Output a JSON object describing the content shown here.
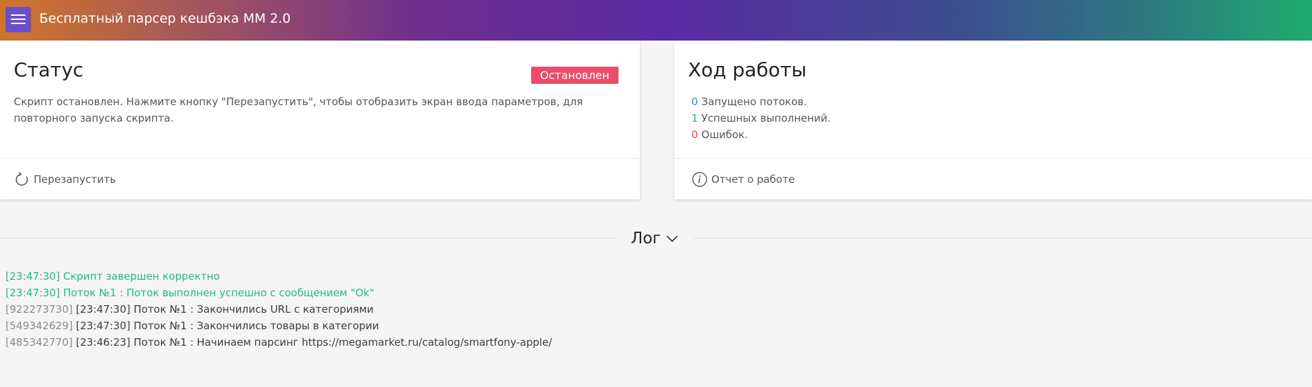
{
  "header": {
    "title": "Бесплатный парсер кешбэка ММ 2.0"
  },
  "status_card": {
    "title": "Статус",
    "badge": "Остановлен",
    "text": "Скрипт остановлен. Нажмите кнопку \"Перезапустить\", чтобы отобразить экран ввода параметров, для повторного запуска скрипта.",
    "action_label": "Перезапустить"
  },
  "progress_card": {
    "title": "Ход работы",
    "threads": {
      "count": "0",
      "label": "Запущено потоков."
    },
    "success": {
      "count": "1",
      "label": "Успешных выполнений."
    },
    "errors": {
      "count": "0",
      "label": "Ошибок."
    },
    "action_label": "Отчет о работе"
  },
  "log": {
    "title": "Лог",
    "entries": [
      {
        "id": "",
        "text": "[23:47:30] Скрипт завершен корректно"
      },
      {
        "id": "",
        "text": "[23:47:30] Поток №1 : Поток выполнен успешно с сообщением \"Ok\""
      },
      {
        "id": "[922273730]",
        "text": "[23:47:30] Поток №1 : Закончились URL с категориями"
      },
      {
        "id": "[549342629]",
        "text": "[23:47:30] Поток №1 : Закончились товары в категории"
      },
      {
        "id": "[485342770]",
        "text": "[23:46:23] Поток №1 : Начинаем парсинг https://megamarket.ru/catalog/smartfony-apple/"
      }
    ]
  },
  "colors": {
    "badge_stopped": "#ea4c6a",
    "count_blue": "#2f8bd8",
    "count_green": "#27b77e",
    "count_red": "#e5474b",
    "log_success": "#27b77e",
    "menu_button": "#6c4fc7"
  },
  "icons": {
    "menu": "hamburger-icon",
    "restart": "refresh-icon",
    "report": "info-icon",
    "log_toggle": "chevron-down-icon"
  }
}
